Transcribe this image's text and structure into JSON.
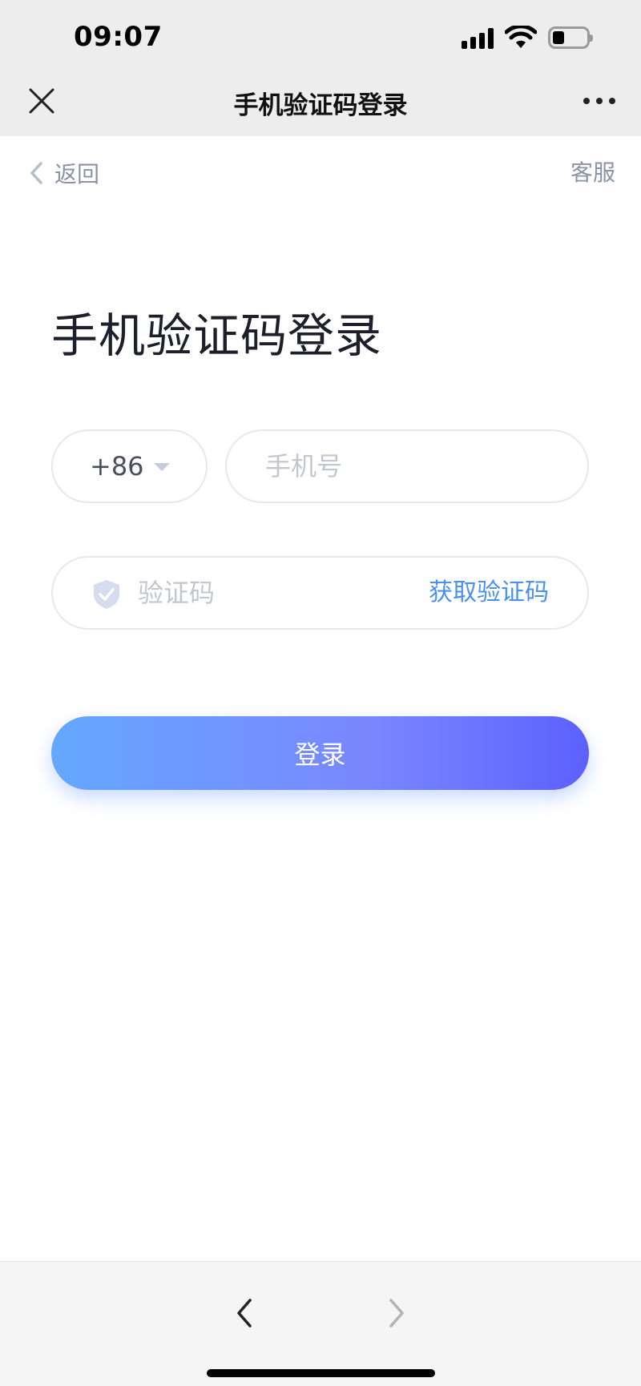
{
  "status_bar": {
    "time": "09:07",
    "battery_level": 0.35
  },
  "nav_header": {
    "title": "手机验证码登录"
  },
  "page_header": {
    "back_label": "返回",
    "service_label": "客服"
  },
  "page_title": "手机验证码登录",
  "form": {
    "country_code": "+86",
    "phone_placeholder": "手机号",
    "phone_value": "",
    "code_placeholder": "验证码",
    "code_value": "",
    "get_code_label": "获取验证码",
    "login_label": "登录"
  },
  "colors": {
    "accent": "#4a8ff2",
    "button_gradient_start": "#64a8ff",
    "button_gradient_end": "#5d60fe",
    "muted_text": "#8a92a6"
  }
}
